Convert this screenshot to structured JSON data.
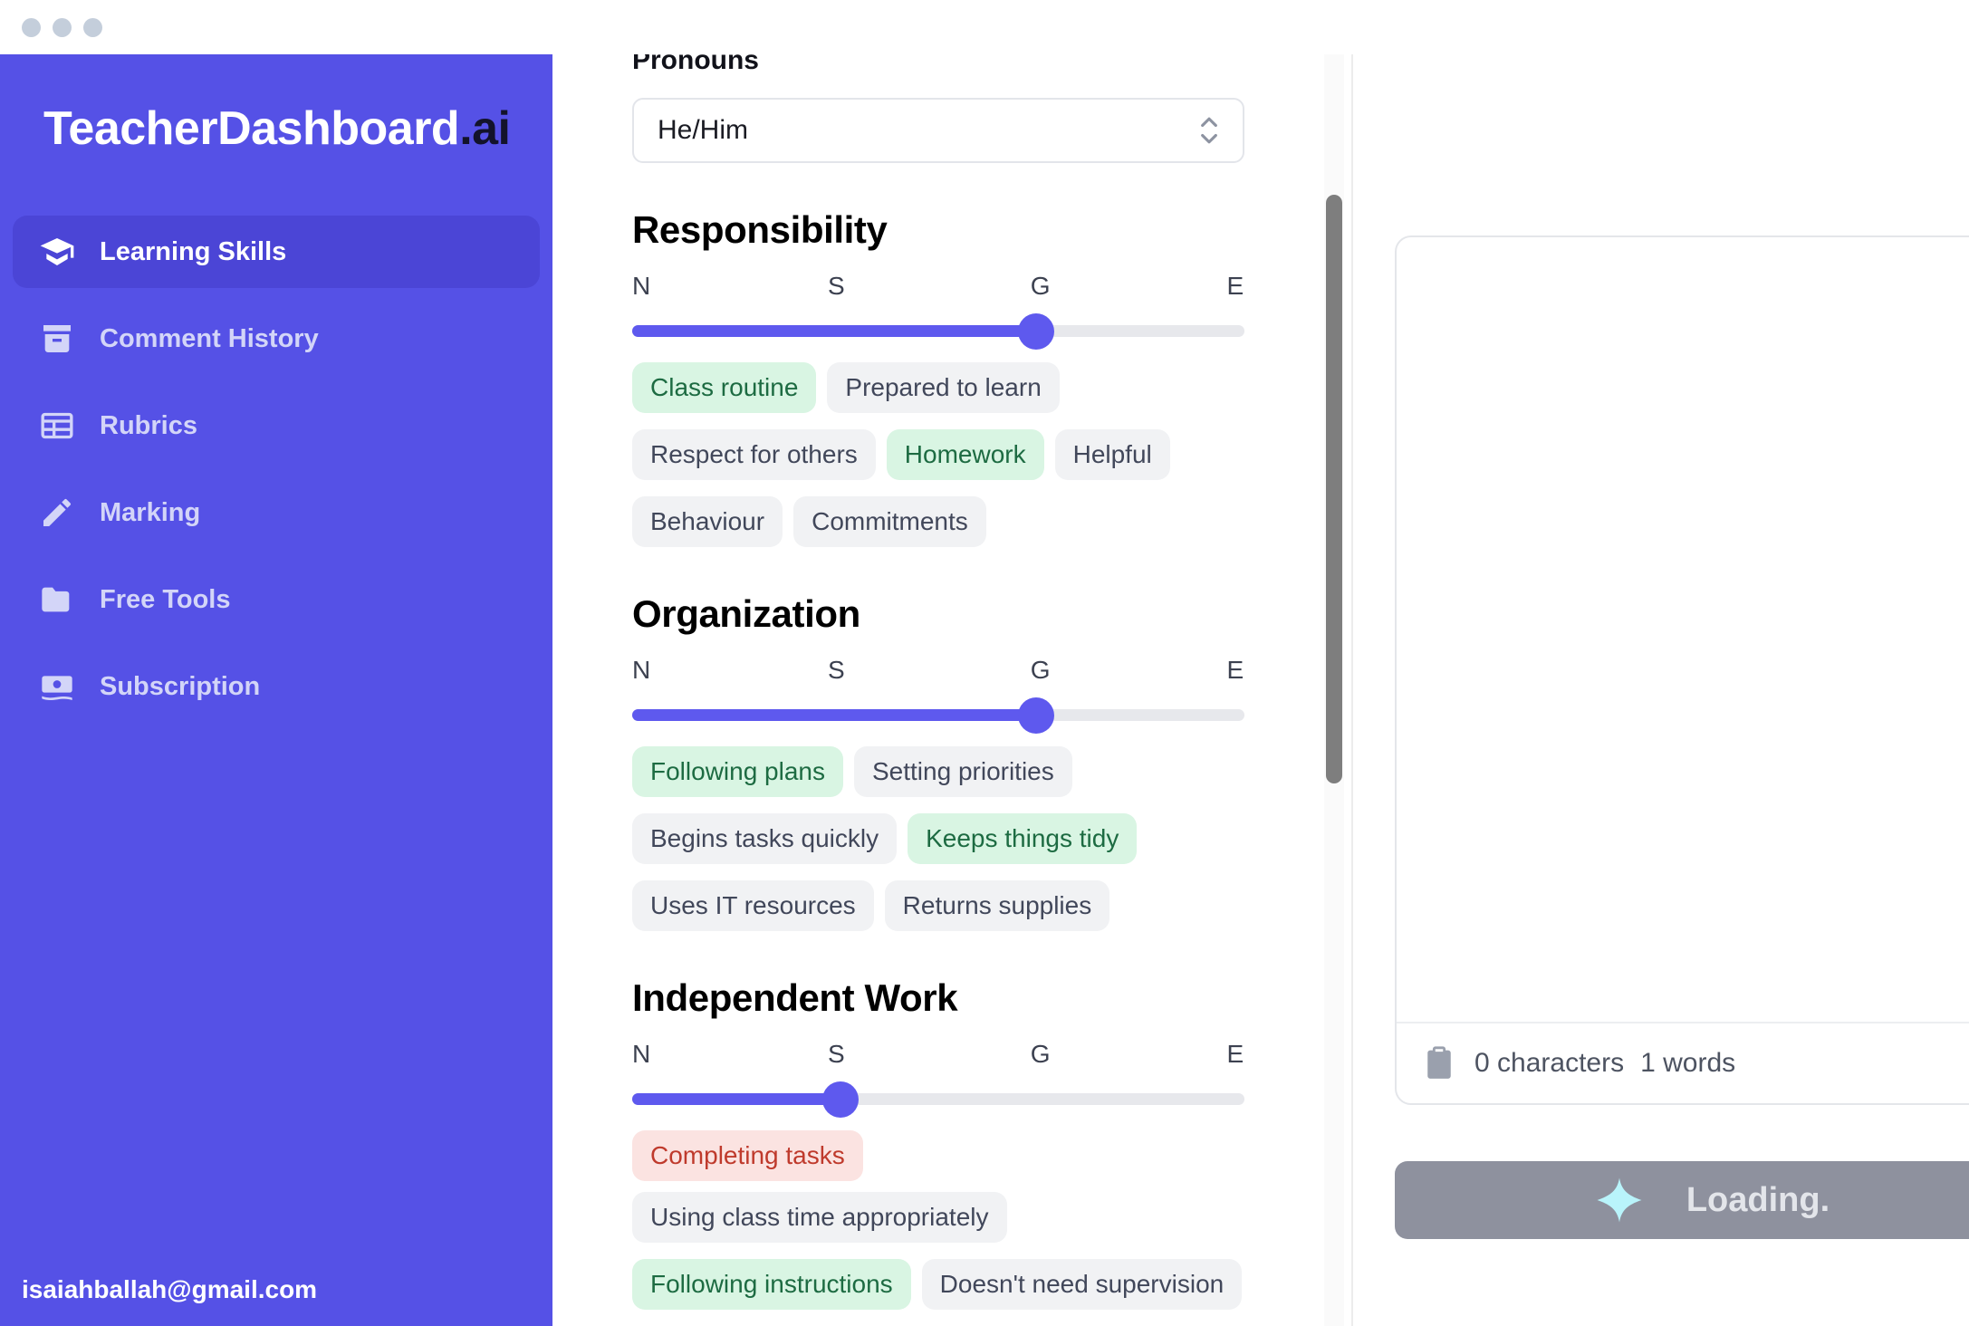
{
  "window": {
    "traffic_lights": [
      "close",
      "minimize",
      "maximize"
    ]
  },
  "sidebar": {
    "brand_name": "TeacherDashboard",
    "brand_suffix": ".ai",
    "items": [
      {
        "label": "Learning Skills",
        "icon": "graduation-cap-icon",
        "active": true
      },
      {
        "label": "Comment History",
        "icon": "archive-box-icon",
        "active": false
      },
      {
        "label": "Rubrics",
        "icon": "table-grid-icon",
        "active": false
      },
      {
        "label": "Marking",
        "icon": "pencil-icon",
        "active": false
      },
      {
        "label": "Free Tools",
        "icon": "folder-icon",
        "active": false
      },
      {
        "label": "Subscription",
        "icon": "banknote-icon",
        "active": false
      }
    ],
    "user_email": "isaiahballah@gmail.com",
    "bg_color": "#5551e6",
    "active_bg_color": "#4b45d6"
  },
  "form": {
    "pronouns_label": "Pronouns",
    "pronouns_value": "He/Him",
    "scale_labels": [
      "N",
      "S",
      "G",
      "E"
    ],
    "accent_color": "#5e59ee",
    "sections": [
      {
        "title": "Responsibility",
        "slider_value": 66,
        "tag_rows": [
          [
            {
              "label": "Class routine",
              "state": "positive"
            },
            {
              "label": "Prepared to learn",
              "state": "neutral"
            }
          ],
          [
            {
              "label": "Respect for others",
              "state": "neutral"
            },
            {
              "label": "Homework",
              "state": "positive"
            },
            {
              "label": "Helpful",
              "state": "neutral"
            }
          ],
          [
            {
              "label": "Behaviour",
              "state": "neutral"
            },
            {
              "label": "Commitments",
              "state": "neutral"
            }
          ]
        ]
      },
      {
        "title": "Organization",
        "slider_value": 66,
        "tag_rows": [
          [
            {
              "label": "Following plans",
              "state": "positive"
            },
            {
              "label": "Setting priorities",
              "state": "neutral"
            }
          ],
          [
            {
              "label": "Begins tasks quickly",
              "state": "neutral"
            },
            {
              "label": "Keeps things tidy",
              "state": "positive"
            }
          ],
          [
            {
              "label": "Uses IT resources",
              "state": "neutral"
            },
            {
              "label": "Returns supplies",
              "state": "neutral"
            }
          ]
        ]
      },
      {
        "title": "Independent Work",
        "slider_value": 34,
        "tag_rows": [
          [
            {
              "label": "Completing tasks",
              "state": "negative"
            },
            {
              "label": "Using class time appropriately",
              "state": "neutral"
            }
          ],
          [
            {
              "label": "Following instructions",
              "state": "positive"
            },
            {
              "label": "Doesn't need supervision",
              "state": "neutral"
            }
          ]
        ]
      }
    ]
  },
  "output": {
    "comment_text": "",
    "character_count": "0 characters",
    "word_count": "1 words",
    "copy_icon": "clipboard-icon",
    "generate_label": "Loading.",
    "generate_icon": "sparkle-icon",
    "generate_bg_color": "#8e919e"
  }
}
